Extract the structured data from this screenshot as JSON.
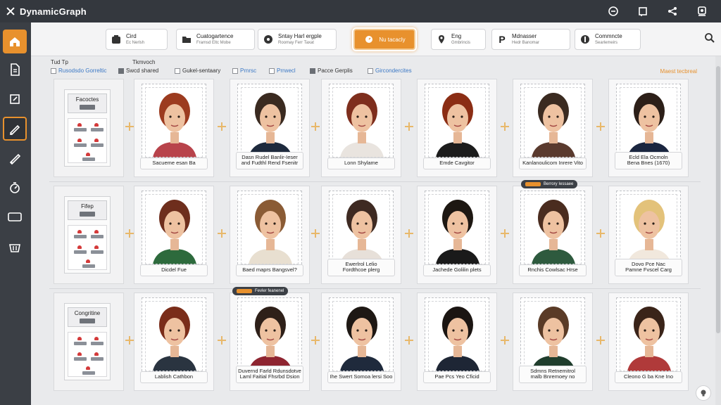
{
  "app": {
    "title": "DynamicGraph",
    "title_icons": [
      "smile-icon",
      "frame-icon",
      "share-icon",
      "badge-icon"
    ]
  },
  "sidebar": {
    "items": [
      {
        "icon": "home-icon"
      },
      {
        "icon": "document-icon"
      },
      {
        "icon": "external-link-icon"
      },
      {
        "icon": "pen-icon"
      },
      {
        "icon": "brush-icon"
      },
      {
        "icon": "timer-icon"
      },
      {
        "icon": "chat-icon"
      },
      {
        "icon": "basket-icon"
      }
    ]
  },
  "toolbar": {
    "buttons": [
      {
        "title": "Cird",
        "sub": "Ec Nerlsh",
        "icon": "stack-icon"
      },
      {
        "title": "Cuatogartence",
        "sub": "Framsd Eltc Mobe",
        "icon": "folder-icon"
      },
      {
        "title": "Sntay Harl ergple",
        "sub": "Roomay Ferr Taxat",
        "icon": "settings-circle-icon"
      },
      {
        "title": "Nu tacacly",
        "sub": "",
        "icon": "clock-icon"
      },
      {
        "title": "Eng",
        "sub": "Gmbrincis",
        "icon": "pin-icon"
      },
      {
        "title": "Mdnasser",
        "sub": "Hedr Banomar",
        "icon": "p-icon"
      },
      {
        "title": "Commncte",
        "sub": "Searlemeirs",
        "icon": "info-circle-icon"
      }
    ]
  },
  "filters": {
    "label1": "Tud Tp",
    "label2": "Tkmvoch",
    "checks": [
      {
        "label": "Rusodsdo Gorreltic",
        "on": false,
        "blue": true
      },
      {
        "label": "Swcd shared",
        "on": true,
        "blue": false
      },
      {
        "label": "Gukel-sentaary",
        "on": false,
        "blue": false
      },
      {
        "label": "Prnrsc",
        "on": false,
        "blue": true
      },
      {
        "label": "Prrwecl",
        "on": false,
        "blue": true
      },
      {
        "label": "Pacce Gerplis",
        "on": true,
        "blue": false
      },
      {
        "label": "Gircondercites",
        "on": false,
        "blue": true
      }
    ],
    "reset": "Maest tecbreal"
  },
  "groups": [
    {
      "label": "Facoctes"
    },
    {
      "label": "Fifep"
    },
    {
      "label": "Congritine"
    }
  ],
  "cards": [
    [
      "Sacueme esan Ba",
      "Dasn Rudel Banlir-Ieser\nand Fudthl Rend Fsenitr",
      "Lonn Shylame",
      "Emde Cavgitor",
      "Kanlanoulicom Inrere Vito",
      "Ecld Ela Ocmoln\nBena Bnes (1670)"
    ],
    [
      "Dicdel Fue",
      "Baed maprs Bangsvel?",
      "Ewerlrol Lelio\nFordthcoe plerg",
      "Jachede Golilin plets",
      "Rnchis Cowlsac Hrse",
      "Dovo Pce Nac\nPamne Fvscel Carg"
    ],
    [
      "Lablish Cathbon",
      "Duvernd Farld Rdunsdotve\nLaml Faitial Fhsrbd Dsion",
      "Ihe Swert Somoa lersi Soo",
      "Pae Pcs Yeo Cficid",
      "Sdmns Retnemitrol\nmalb Bnremoey no",
      "Cleono G ba Kne Ino"
    ]
  ],
  "pills": [
    {
      "text": "Berrory Iessaee"
    },
    {
      "text": "Fevler feanenel"
    }
  ]
}
